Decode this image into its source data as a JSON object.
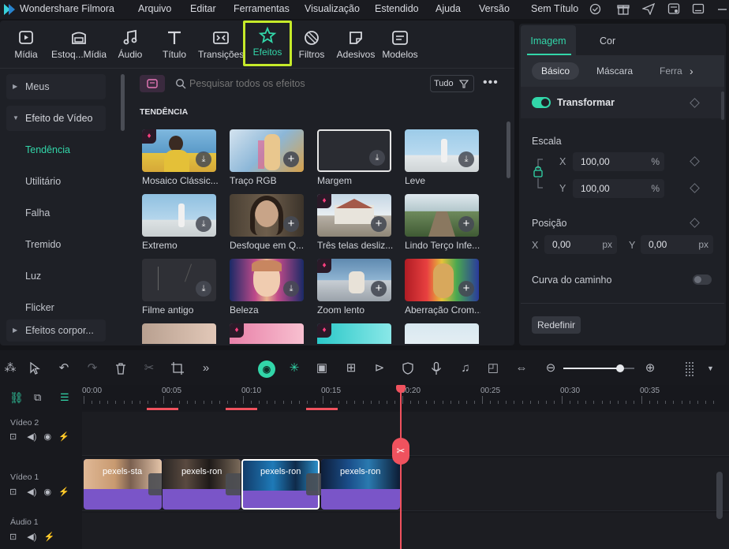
{
  "app": {
    "title": "Wondershare Filmora"
  },
  "menu": {
    "items": [
      "Arquivo",
      "Editar",
      "Ferramentas",
      "Visualização",
      "Estendido",
      "Ajuda",
      "Versão"
    ],
    "project_title": "Sem Título"
  },
  "toolbar": {
    "tools": [
      {
        "label": "Mídia",
        "icon": "media-icon"
      },
      {
        "label": "Estoq...Mídia",
        "icon": "stock-media-icon"
      },
      {
        "label": "Áudio",
        "icon": "music-note-icon"
      },
      {
        "label": "Título",
        "icon": "title-t-icon"
      },
      {
        "label": "Transições",
        "icon": "transitions-icon"
      },
      {
        "label": "Efeitos",
        "icon": "effects-star-icon",
        "active": true
      },
      {
        "label": "Filtros",
        "icon": "filters-icon"
      },
      {
        "label": "Adesivos",
        "icon": "stickers-icon"
      },
      {
        "label": "Modelos",
        "icon": "templates-icon"
      }
    ]
  },
  "sidebar": {
    "items": [
      {
        "label": "Meus",
        "kind": "group-collapsed"
      },
      {
        "label": "Efeito de Vídeo",
        "kind": "group-expanded"
      },
      {
        "label": "Tendência",
        "kind": "active"
      },
      {
        "label": "Utilitário",
        "kind": "item"
      },
      {
        "label": "Falha",
        "kind": "item"
      },
      {
        "label": "Tremido",
        "kind": "item"
      },
      {
        "label": "Luz",
        "kind": "item"
      },
      {
        "label": "Flicker",
        "kind": "item"
      },
      {
        "label": "Efeitos corpor...",
        "kind": "group-collapsed"
      }
    ]
  },
  "search": {
    "placeholder": "Pesquisar todos os efeitos",
    "filter_label": "Tudo"
  },
  "effects": {
    "section_title": "TENDÊNCIA",
    "items": [
      {
        "label": "Mosaico Clássic...",
        "premium": true,
        "action": "download"
      },
      {
        "label": "Traço RGB",
        "premium": false,
        "action": "add"
      },
      {
        "label": "Margem",
        "premium": false,
        "action": "download"
      },
      {
        "label": "Leve",
        "premium": false,
        "action": "download"
      },
      {
        "label": "Extremo",
        "premium": false,
        "action": "download"
      },
      {
        "label": "Desfoque em Q...",
        "premium": false,
        "action": "add"
      },
      {
        "label": "Três telas desliz...",
        "premium": true,
        "action": "add"
      },
      {
        "label": "Lindo Terço Infe...",
        "premium": false,
        "action": "add"
      },
      {
        "label": "Filme antigo",
        "premium": false,
        "action": "download"
      },
      {
        "label": "Beleza",
        "premium": false,
        "action": "download"
      },
      {
        "label": "Zoom lento",
        "premium": true,
        "action": "add"
      },
      {
        "label": "Aberração Crom...",
        "premium": false,
        "action": "add"
      }
    ]
  },
  "properties": {
    "tabs": [
      "Imagem",
      "Cor"
    ],
    "active_tab": "Imagem",
    "subtabs": [
      "Básico",
      "Máscara",
      "Ferra"
    ],
    "active_subtab": "Básico",
    "transform_label": "Transformar",
    "transform_enabled": true,
    "scale_label": "Escala",
    "scale_x_label": "X",
    "scale_x": "100,00",
    "scale_y_label": "Y",
    "scale_y": "100,00",
    "percent_unit": "%",
    "position_label": "Posição",
    "pos_x_label": "X",
    "pos_x": "0,00",
    "pos_y_label": "Y",
    "pos_y": "0,00",
    "px_unit": "px",
    "path_curve_label": "Curva do caminho",
    "path_curve_enabled": false,
    "reset_label": "Redefinir"
  },
  "timeline": {
    "ticks": [
      "00:00",
      "00:05",
      "00:10",
      "00:15",
      "00:20",
      "00:25",
      "00:30",
      "00:35"
    ],
    "zoom_level": 0.8,
    "tracks": [
      {
        "label": "Vídeo 2"
      },
      {
        "label": "Vídeo 1"
      },
      {
        "label": "Áudio 1"
      }
    ],
    "clips": [
      {
        "label": "pexels-sta"
      },
      {
        "label": "pexels-ron"
      },
      {
        "label": "pexels-ron",
        "selected": true
      },
      {
        "label": "pexels-ron"
      }
    ]
  },
  "colors": {
    "accent": "#32d6a9",
    "highlight": "#c6ea2a",
    "playhead": "#f0525e",
    "clip": "#7a55c8"
  }
}
